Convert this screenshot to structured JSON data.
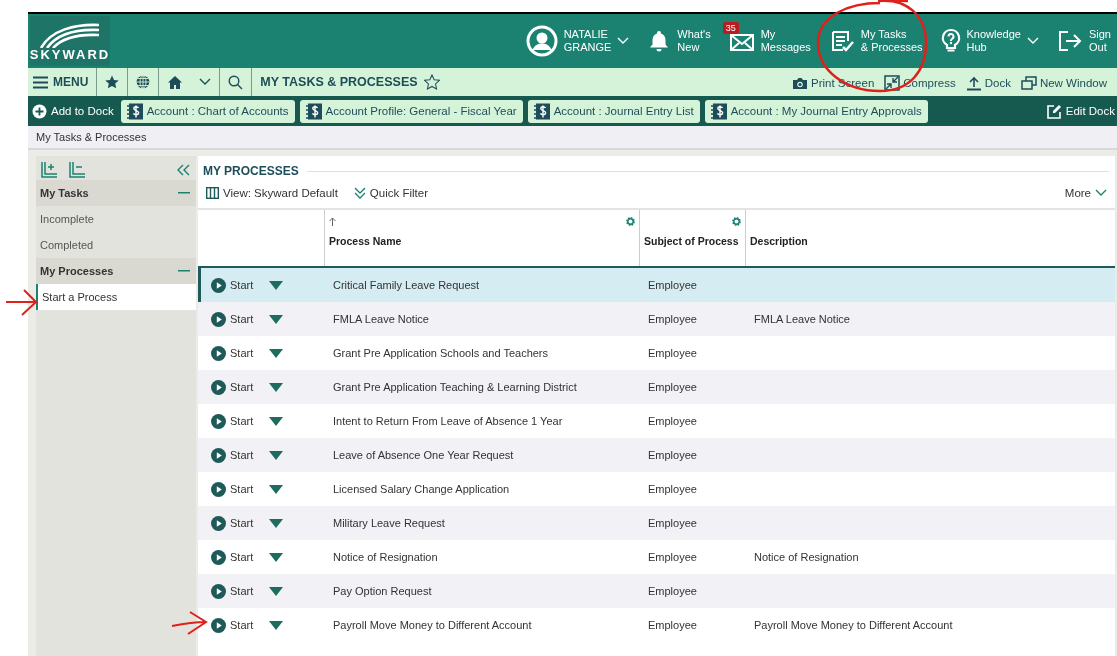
{
  "header": {
    "logo_text": "SKYWARD",
    "user": {
      "line1": "NATALIE",
      "line2": "GRANGE"
    },
    "items": [
      {
        "kind": "bell",
        "line1": "What's",
        "line2": "New"
      },
      {
        "kind": "mail",
        "line1": "My",
        "line2": "Messages",
        "badge": "35"
      },
      {
        "kind": "tasks",
        "line1": "My Tasks",
        "line2": "& Processes"
      },
      {
        "kind": "help",
        "line1": "Knowledge",
        "line2": "Hub",
        "dropdown": true
      },
      {
        "kind": "signout",
        "line1": "Sign",
        "line2": "Out"
      }
    ]
  },
  "nav": {
    "menu": "MENU",
    "title": "MY TASKS & PROCESSES",
    "actions": [
      {
        "kind": "camera",
        "label": "Print Screen"
      },
      {
        "kind": "compress",
        "label": "Compress"
      },
      {
        "kind": "dock",
        "label": "Dock"
      },
      {
        "kind": "window",
        "label": "New Window"
      }
    ]
  },
  "dock": {
    "add": "Add to Dock",
    "edit": "Edit Dock",
    "chips": [
      "Account : Chart of Accounts",
      "Account Profile: General - Fiscal Year",
      "Account : Journal Entry List",
      "Account : My Journal Entry Approvals"
    ]
  },
  "breadcrumb": "My Tasks & Processes",
  "sidebar": {
    "sections": [
      {
        "title": "My Tasks",
        "expanded": true,
        "items": [
          {
            "label": "Incomplete",
            "selected": false
          },
          {
            "label": "Completed",
            "selected": false
          }
        ]
      },
      {
        "title": "My Processes",
        "expanded": true,
        "items": [
          {
            "label": "Start a Process",
            "selected": true
          }
        ]
      }
    ]
  },
  "main": {
    "title": "MY PROCESSES",
    "view": "View: Skyward Default",
    "filter": "Quick Filter",
    "more": "More",
    "columns": [
      {
        "label": "Process Name",
        "sorted_ascending": true,
        "settings": true
      },
      {
        "label": "Subject of Process",
        "settings": true
      },
      {
        "label": "Description"
      }
    ],
    "rows": [
      {
        "action": "Start",
        "name": "Critical Family Leave Request",
        "subject": "Employee",
        "selected": true
      },
      {
        "action": "Start",
        "name": "FMLA Leave Notice",
        "subject": "Employee",
        "description": "FMLA Leave Notice",
        "selected": false
      },
      {
        "action": "Start",
        "name": "Grant Pre Application Schools and Teachers",
        "subject": "Employee",
        "selected": false
      },
      {
        "action": "Start",
        "name": "Grant Pre Application Teaching & Learning District",
        "subject": "Employee",
        "selected": false
      },
      {
        "action": "Start",
        "name": "Intent to Return From Leave of Absence 1 Year",
        "subject": "Employee",
        "selected": false
      },
      {
        "action": "Start",
        "name": "Leave of Absence One Year Request",
        "subject": "Employee",
        "selected": false
      },
      {
        "action": "Start",
        "name": "Licensed Salary Change Application",
        "subject": "Employee",
        "selected": false
      },
      {
        "action": "Start",
        "name": "Military Leave Request",
        "subject": "Employee",
        "selected": false
      },
      {
        "action": "Start",
        "name": "Notice of Resignation",
        "subject": "Employee",
        "description": "Notice of Resignation",
        "selected": false
      },
      {
        "action": "Start",
        "name": "Pay Option Request",
        "subject": "Employee",
        "selected": false
      },
      {
        "action": "Start",
        "name": "Payroll Move Money to Different Account",
        "subject": "Employee",
        "description": "Payroll Move Money to Different Account",
        "selected": false
      }
    ]
  },
  "annotations": [
    {
      "kind": "circle"
    },
    {
      "kind": "arrow"
    },
    {
      "kind": "arrow"
    }
  ]
}
